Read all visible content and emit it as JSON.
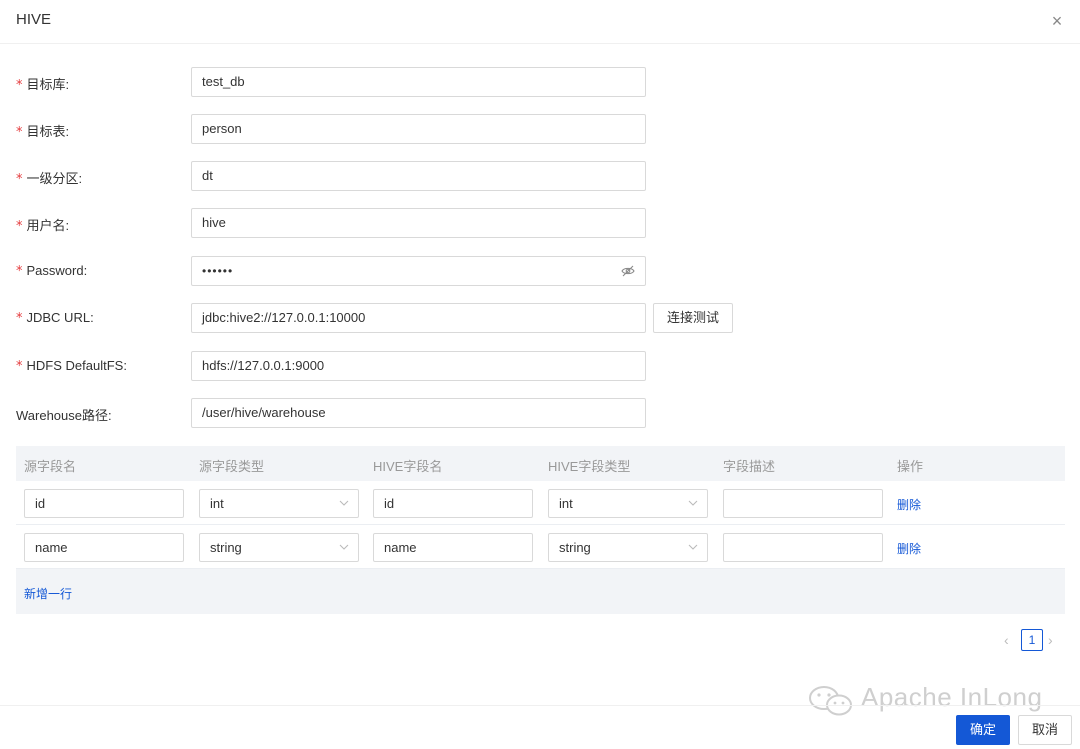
{
  "modal": {
    "title": "HIVE",
    "close_glyph": "×"
  },
  "form": {
    "fields": [
      {
        "label": "目标库",
        "required": true,
        "value": "test_db"
      },
      {
        "label": "目标表",
        "required": true,
        "value": "person"
      },
      {
        "label": "一级分区",
        "required": true,
        "value": "dt"
      },
      {
        "label": "用户名",
        "required": true,
        "value": "hive"
      },
      {
        "label": "Password",
        "required": true,
        "value": "••••••",
        "icon": "eye-off-icon"
      },
      {
        "label": "JDBC URL",
        "required": true,
        "value": "jdbc:hive2://127.0.0.1:10000"
      },
      {
        "label": "HDFS DefaultFS",
        "required": true,
        "value": "hdfs://127.0.0.1:9000"
      },
      {
        "label": "Warehouse路径",
        "required": false,
        "value": "/user/hive/warehouse"
      }
    ],
    "required_mark": "*",
    "label_suffix": ":",
    "test_button_label": "连接测试"
  },
  "table": {
    "columns": [
      "源字段名",
      "源字段类型",
      "HIVE字段名",
      "HIVE字段类型",
      "字段描述",
      "操作"
    ],
    "rows": [
      {
        "source_name": "id",
        "source_type": "int",
        "hive_name": "id",
        "hive_type": "int",
        "description": "",
        "action": "删除"
      },
      {
        "source_name": "name",
        "source_type": "string",
        "hive_name": "name",
        "hive_type": "string",
        "description": "",
        "action": "删除"
      }
    ],
    "add_row_label": "新增一行"
  },
  "pagination": {
    "prev_glyph": "‹",
    "current_page": "1",
    "next_glyph": "›"
  },
  "watermark": {
    "text": "Apache InLong",
    "icon": "wechat-icon"
  },
  "footer": {
    "ok_label": "确定",
    "cancel_label": "取消"
  },
  "colors": {
    "accent": "#1458d6",
    "required": "#e4393c",
    "table_header_bg": "#f2f4f7"
  }
}
